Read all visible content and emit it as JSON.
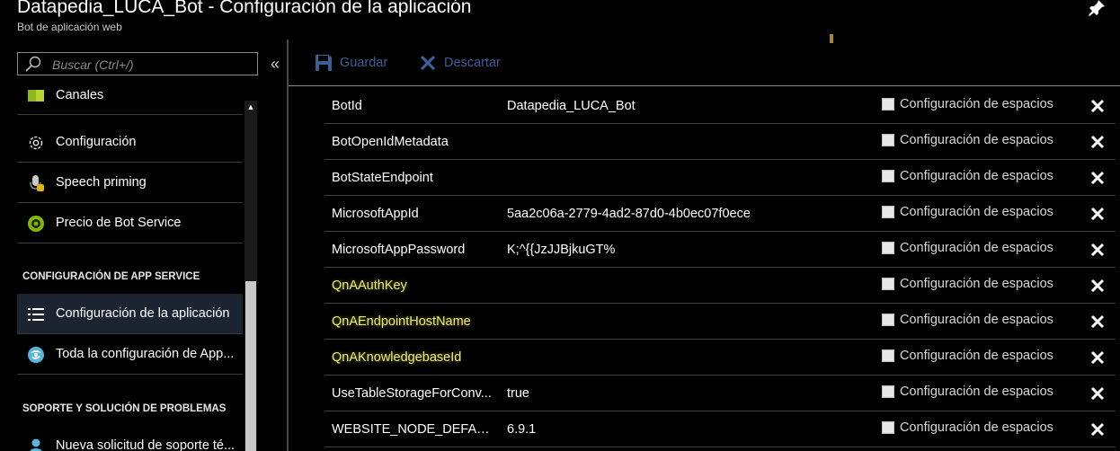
{
  "window": {
    "title": "Datapedia_LUCA_Bot - Configuración de la aplicación",
    "subtitle": "Bot de aplicación web"
  },
  "sidebar": {
    "search_placeholder": "Buscar (Ctrl+/)",
    "collapse_label": "«",
    "items": [
      {
        "label": "Canales",
        "icon": "channels-icon"
      },
      {
        "label": "Configuración",
        "icon": "gear-icon"
      },
      {
        "label": "Speech priming",
        "icon": "speech-priming-icon"
      },
      {
        "label": "Precio de Bot Service",
        "icon": "pricing-icon"
      }
    ],
    "section_app_service": "CONFIGURACIÓN DE APP SERVICE",
    "app_service_items": [
      {
        "label": "Configuración de la aplicación",
        "icon": "list-icon",
        "active": true
      },
      {
        "label": "Toda la configuración de App...",
        "icon": "app-service-icon"
      }
    ],
    "section_support": "SOPORTE Y SOLUCIÓN DE PROBLEMAS",
    "support_items": [
      {
        "label": "Nueva solicitud de soporte té...",
        "icon": "support-person-icon"
      }
    ]
  },
  "toolbar": {
    "save_label": "Guardar",
    "discard_label": "Descartar"
  },
  "settings": {
    "slot_label": "Configuración de espacios",
    "rows": [
      {
        "name": "BotId",
        "value": "Datapedia_LUCA_Bot",
        "highlight": false
      },
      {
        "name": "BotOpenIdMetadata",
        "value": "",
        "highlight": false
      },
      {
        "name": "BotStateEndpoint",
        "value": "",
        "highlight": false
      },
      {
        "name": "MicrosoftAppId",
        "value": "5aa2c06a-2779-4ad2-87d0-4b0ec07f0ece",
        "highlight": false
      },
      {
        "name": "MicrosoftAppPassword",
        "value": "K;^{{JzJJBjkuGT%",
        "highlight": false
      },
      {
        "name": "QnAAuthKey",
        "value": "",
        "highlight": true
      },
      {
        "name": "QnAEndpointHostName",
        "value": "",
        "highlight": true
      },
      {
        "name": "QnAKnowledgebaseId",
        "value": "",
        "highlight": true
      },
      {
        "name": "UseTableStorageForConv...",
        "value": "true",
        "highlight": false
      },
      {
        "name": "WEBSITE_NODE_DEFAULT...",
        "value": "6.9.1",
        "highlight": false
      }
    ]
  },
  "colors": {
    "background": "#000000",
    "toolbar_text": "#3a5f96",
    "highlight_text": "#f0f070",
    "active_nav": "#1b2430"
  }
}
